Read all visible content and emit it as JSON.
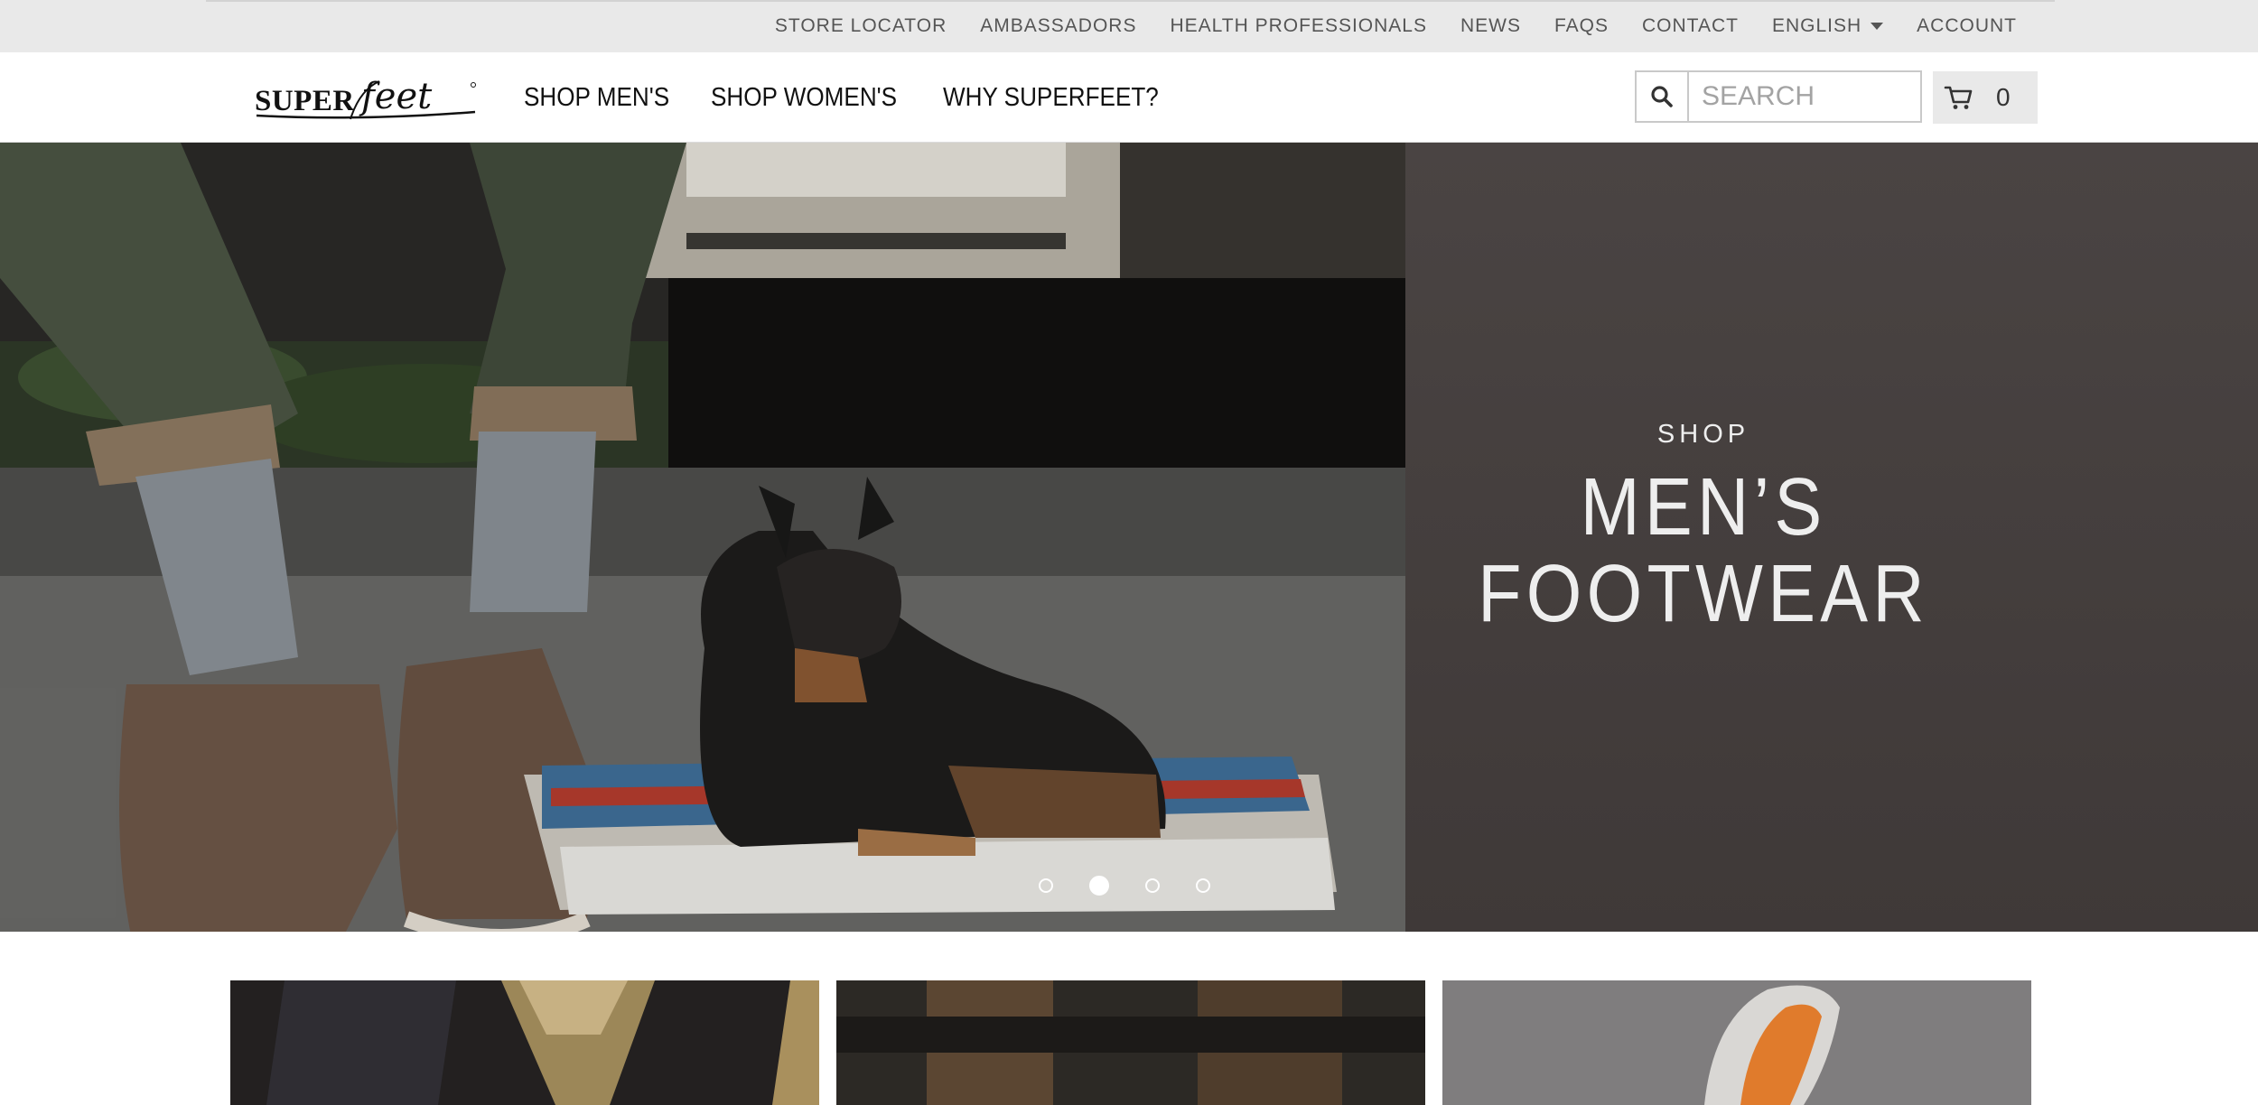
{
  "utility_bar": {
    "links": [
      {
        "label": "STORE LOCATOR"
      },
      {
        "label": "AMBASSADORS"
      },
      {
        "label": "HEALTH PROFESSIONALS"
      },
      {
        "label": "NEWS"
      },
      {
        "label": "FAQS"
      },
      {
        "label": "CONTACT"
      },
      {
        "label": "ENGLISH"
      },
      {
        "label": "ACCOUNT"
      }
    ]
  },
  "header": {
    "logo_text": "SUPERfeet",
    "nav": [
      {
        "label": "SHOP MEN'S"
      },
      {
        "label": "SHOP WOMEN'S"
      },
      {
        "label": "WHY SUPERFEET?"
      }
    ],
    "search": {
      "placeholder": "SEARCH",
      "icon": "search-icon"
    },
    "cart": {
      "count": "0",
      "icon": "cart-icon"
    }
  },
  "hero": {
    "eyebrow": "SHOP",
    "title_line1": "MEN’S",
    "title_line2": "FOOTWEAR",
    "slides_total": 4,
    "active_slide": 2
  },
  "tiles": [
    {
      "name": "tile-1"
    },
    {
      "name": "tile-2"
    },
    {
      "name": "tile-3"
    }
  ],
  "colors": {
    "utility_bg": "#e9e9e9",
    "hero_panel": "#453f3e",
    "text_dark": "#111111",
    "text_muted": "#555555"
  }
}
